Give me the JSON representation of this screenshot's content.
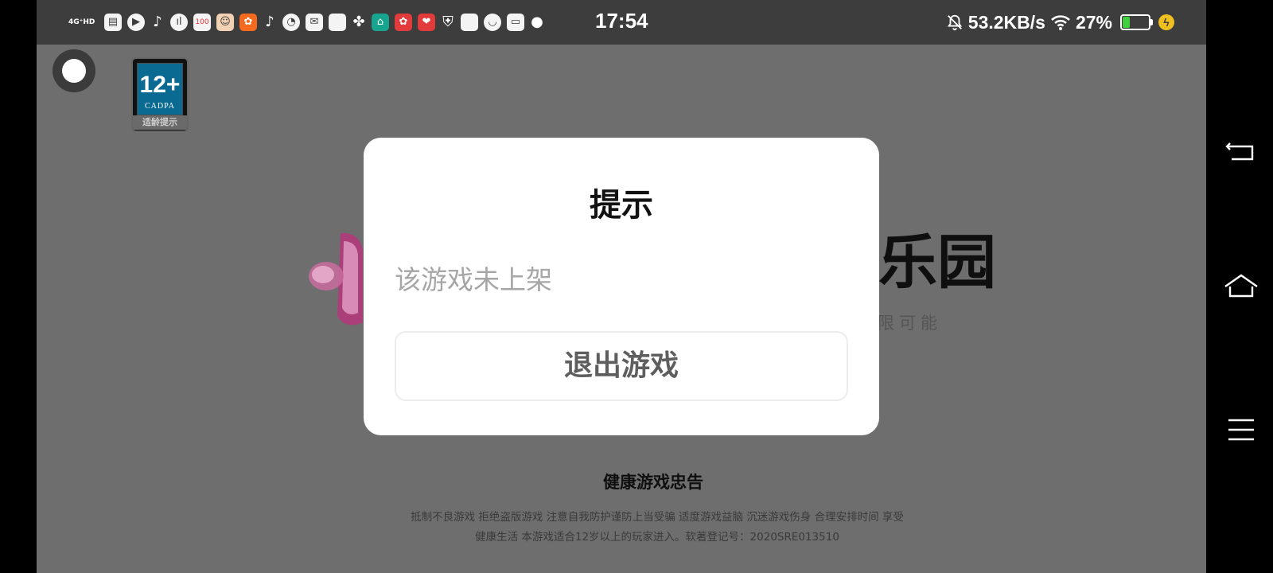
{
  "status_bar": {
    "network": "4G⁺HD",
    "time": "17:54",
    "speed": "53.2KB/s",
    "battery_percent": "27%",
    "battery_level": 0.27,
    "icons": [
      "calendar-icon",
      "play-icon",
      "tiktok-icon",
      "voice-icon",
      "score-100-icon",
      "avatar-app-icon",
      "app-orange-icon",
      "tiktok-icon",
      "speedometer-icon",
      "mail-icon",
      "square-icon",
      "pinwheel-icon",
      "home-app-icon",
      "app-red-icon",
      "app-red-heart-icon",
      "shield-icon",
      "square-icon",
      "mask-icon",
      "card-icon",
      "chat-icon"
    ]
  },
  "age_badge": {
    "rating": "12+",
    "org": "CADPA",
    "label": "适龄提示"
  },
  "game_logo": {
    "title_fragment": "乐园",
    "subtitle_fragment": "限可能"
  },
  "health_advice": {
    "title": "健康游戏忠告",
    "line1": "抵制不良游戏 拒绝盗版游戏 注意自我防护谨防上当受骗 适度游戏益脑 沉迷游戏伤身 合理安排时间 享受",
    "line2": "健康生活 本游戏适合12岁以上的玩家进入。软著登记号：2020SRE013510"
  },
  "dialog": {
    "title": "提示",
    "message": "该游戏未上架",
    "exit_button": "退出游戏"
  },
  "colors": {
    "overlay": "#6e6e6e",
    "statusbar": "#3d3d3d",
    "dialog_bg": "#ffffff",
    "battery_green": "#3fcf3f",
    "charge_yellow": "#f0c020"
  }
}
